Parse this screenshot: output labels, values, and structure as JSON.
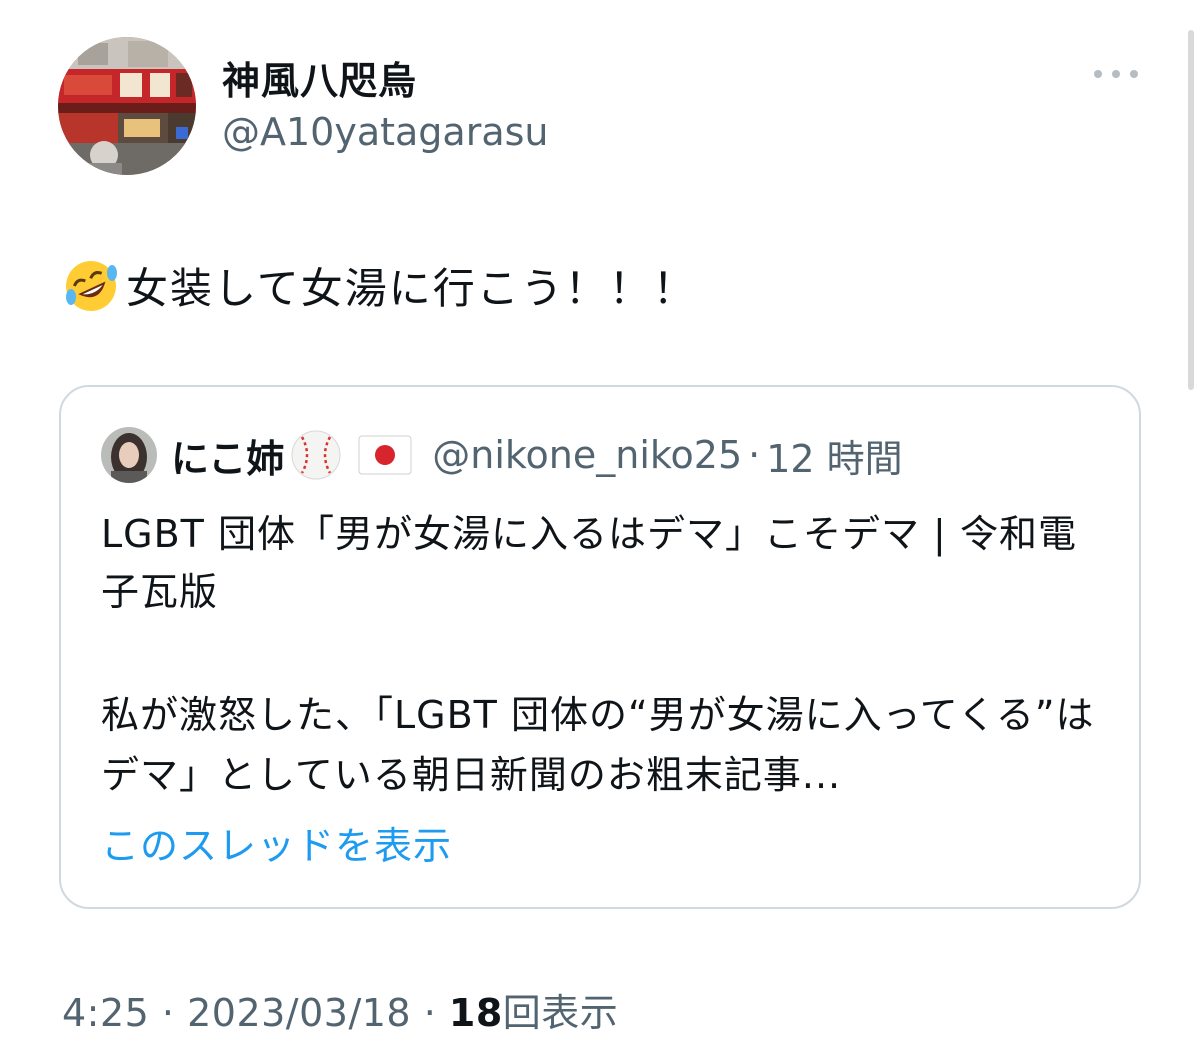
{
  "author": {
    "display_name": "神風八咫烏",
    "handle": "@A10yatagarasu",
    "avatar_icon": "ramen-shop-avatar"
  },
  "menu": {
    "icon": "more-dots-icon"
  },
  "tweet": {
    "emoji_icon": "rolling-on-floor-laughing-emoji",
    "text": "女装して女湯に行こう！！！"
  },
  "quote": {
    "display_name": "にこ姉",
    "name_emoji_icon": "baseball-emoji",
    "flag_icon": "japan-flag-emoji",
    "handle": "@nikone_niko25",
    "separator": "·",
    "time": "12 時間",
    "title": "LGBT 団体「男が女湯に入るはデマ」こそデマ | 令和電子瓦版",
    "body": "私が激怒した、「LGBT 団体の“男が女湯に入ってくる”はデマ」としている朝日新聞のお粗末記事...",
    "show_thread": "このスレッドを表示"
  },
  "meta": {
    "time": "4:25",
    "sep1": " · ",
    "date": "2023/03/18",
    "sep2": " · ",
    "views_count": "18",
    "views_label": "回表示"
  },
  "colors": {
    "text": "#0f1419",
    "secondary": "#536471",
    "link": "#1d9bf0",
    "border": "#cfd9de"
  }
}
